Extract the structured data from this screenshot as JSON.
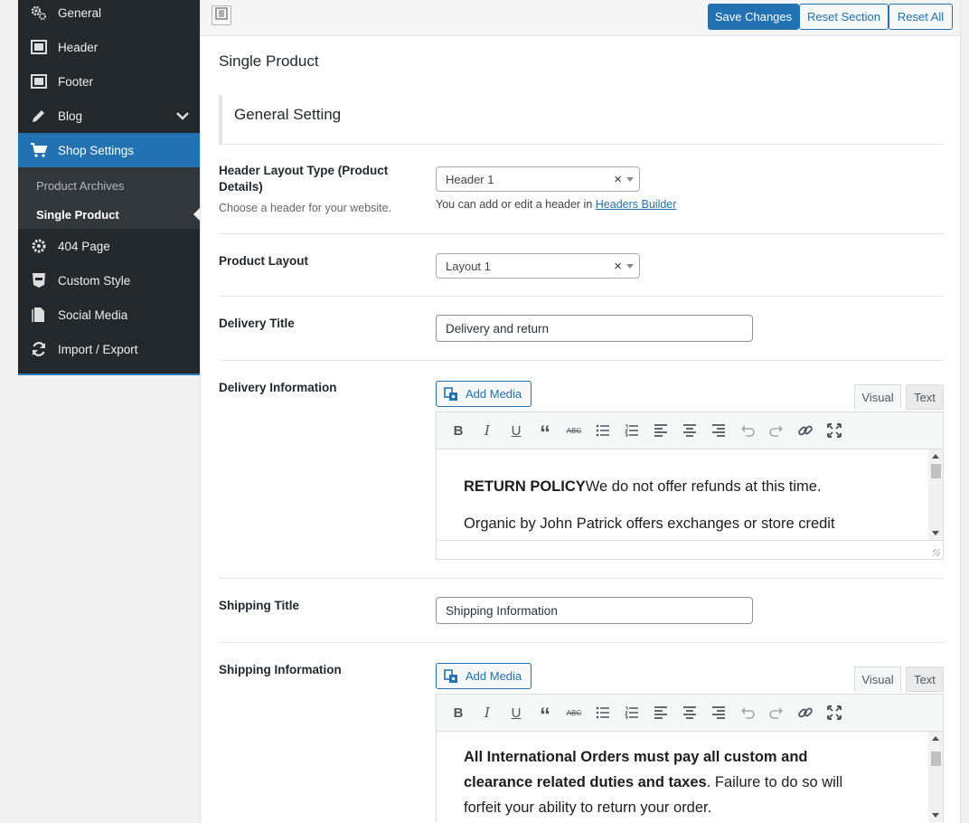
{
  "sidebar": {
    "items": [
      {
        "label": "General",
        "icon": "gears-icon"
      },
      {
        "label": "Header",
        "icon": "header-icon"
      },
      {
        "label": "Footer",
        "icon": "footer-icon"
      },
      {
        "label": "Blog",
        "icon": "pencil-icon"
      },
      {
        "label": "Shop Settings",
        "icon": "cart-icon"
      },
      {
        "label": "404 Page",
        "icon": "gear-icon"
      },
      {
        "label": "Custom Style",
        "icon": "css-icon"
      },
      {
        "label": "Social Media",
        "icon": "document-icon"
      },
      {
        "label": "Import / Export",
        "icon": "refresh-icon"
      }
    ],
    "sub_items": [
      {
        "label": "Product Archives"
      },
      {
        "label": "Single Product"
      }
    ]
  },
  "toolbar": {
    "save_label": "Save Changes",
    "reset_section_label": "Reset Section",
    "reset_all_label": "Reset All"
  },
  "main": {
    "title": "Single Product",
    "group_title": "General Setting",
    "header_layout": {
      "label": "Header Layout Type (Product Details)",
      "desc": "Choose a header for your website.",
      "value": "Header 1",
      "help_prefix": "You can add or edit a header in",
      "help_link": "Headers Builder"
    },
    "product_layout": {
      "label": "Product Layout",
      "value": "Layout 1"
    },
    "delivery_title": {
      "label": "Delivery Title",
      "value": "Delivery and return"
    },
    "delivery_info": {
      "label": "Delivery Information",
      "add_media": "Add Media",
      "tab_visual": "Visual",
      "tab_text": "Text",
      "bold_text": "RETURN POLICY",
      "text1": "We do not offer refunds at this time.",
      "text2": "Organic by John Patrick offers exchanges or store credit"
    },
    "shipping_title": {
      "label": "Shipping Title",
      "value": "Shipping Information"
    },
    "shipping_info": {
      "label": "Shipping Information",
      "add_media": "Add Media",
      "tab_visual": "Visual",
      "tab_text": "Text",
      "bold_line1": "All International Orders must pay all custom and",
      "bold_line2": "clearance related duties and taxes",
      "rest_line2": ". Failure to do so will",
      "line3": "forfeit your ability to return your order."
    }
  },
  "colors": {
    "accent": "#2271b1",
    "sidebar_bg": "#23282d",
    "submenu_bg": "#32373c"
  }
}
